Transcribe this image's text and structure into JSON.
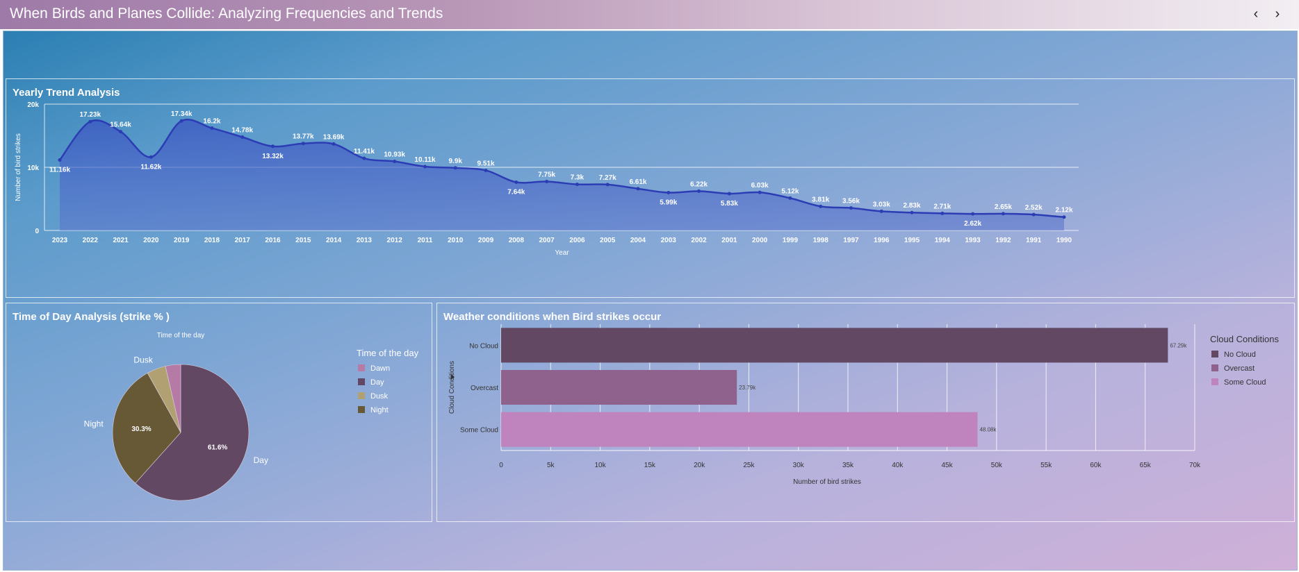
{
  "header": {
    "title": "When Birds and Planes Collide: Analyzing Frequencies and Trends",
    "prev_icon": "chevron-left-icon",
    "next_icon": "chevron-right-icon",
    "prev_label": "‹",
    "next_label": "›"
  },
  "panels": {
    "trend_title": "Yearly Trend Analysis",
    "time_title": "Time of Day Analysis (strike % )",
    "weather_title": "Weather conditions when Bird strikes occur"
  },
  "colors": {
    "line": "#2c3cb4",
    "day": "#624863",
    "night": "#675836",
    "dusk": "#b1a172",
    "dawn": "#b57ba6",
    "no_cloud": "#624863",
    "overcast": "#8e628c",
    "some_cloud": "#bf84bd"
  },
  "chart_data": [
    {
      "type": "area",
      "title": "Yearly Trend Analysis",
      "xlabel": "Year",
      "ylabel": "Number of bird strikes",
      "yticks": [
        "0",
        "10k",
        "20k"
      ],
      "ylim": [
        0,
        20000
      ],
      "categories": [
        "2023",
        "2022",
        "2021",
        "2020",
        "2019",
        "2018",
        "2017",
        "2016",
        "2015",
        "2014",
        "2013",
        "2012",
        "2011",
        "2010",
        "2009",
        "2008",
        "2007",
        "2006",
        "2005",
        "2004",
        "2003",
        "2002",
        "2001",
        "2000",
        "1999",
        "1998",
        "1997",
        "1996",
        "1995",
        "1994",
        "1993",
        "1992",
        "1991",
        "1990"
      ],
      "values": [
        11160,
        17230,
        15640,
        11620,
        17340,
        16200,
        14780,
        13320,
        13770,
        13690,
        11410,
        10930,
        10110,
        9900,
        9510,
        7640,
        7750,
        7300,
        7270,
        6610,
        5990,
        6220,
        5830,
        6030,
        5120,
        3810,
        3560,
        3030,
        2830,
        2710,
        2620,
        2650,
        2520,
        2120
      ],
      "labels": [
        "11.16k",
        "17.23k",
        "15.64k",
        "11.62k",
        "17.34k",
        "16.2k",
        "14.78k",
        "13.32k",
        "13.77k",
        "13.69k",
        "11.41k",
        "10.93k",
        "10.11k",
        "9.9k",
        "9.51k",
        "7.64k",
        "7.75k",
        "7.3k",
        "7.27k",
        "6.61k",
        "5.99k",
        "6.22k",
        "5.83k",
        "6.03k",
        "5.12k",
        "3.81k",
        "3.56k",
        "3.03k",
        "2.83k",
        "2.71k",
        "2.62k",
        "2.65k",
        "2.52k",
        "2.12k"
      ],
      "grid": true
    },
    {
      "type": "pie",
      "title": "Time of the day",
      "legend_title": "Time of the day",
      "legend_position": "right",
      "slices": [
        {
          "name": "Day",
          "value": 61.6,
          "label": "61.6%"
        },
        {
          "name": "Night",
          "value": 30.3,
          "label": "30.3%"
        },
        {
          "name": "Dusk",
          "value": 4.5,
          "label": ""
        },
        {
          "name": "Dawn",
          "value": 3.6,
          "label": ""
        }
      ],
      "legend": [
        "Dawn",
        "Day",
        "Dusk",
        "Night"
      ]
    },
    {
      "type": "bar",
      "orientation": "horizontal",
      "xlabel": "Number of bird strikes",
      "ylabel": "Cloud Conditions",
      "legend_title": "Cloud Conditions",
      "legend_position": "right",
      "categories": [
        "No Cloud",
        "Overcast",
        "Some Cloud"
      ],
      "values": [
        67290,
        23790,
        48080
      ],
      "labels": [
        "67.29k",
        "23.79k",
        "48.08k"
      ],
      "xlim": [
        0,
        70000
      ],
      "xticks": [
        "0",
        "5k",
        "10k",
        "15k",
        "20k",
        "25k",
        "30k",
        "35k",
        "40k",
        "45k",
        "50k",
        "55k",
        "60k",
        "65k",
        "70k"
      ],
      "grid": true
    }
  ]
}
